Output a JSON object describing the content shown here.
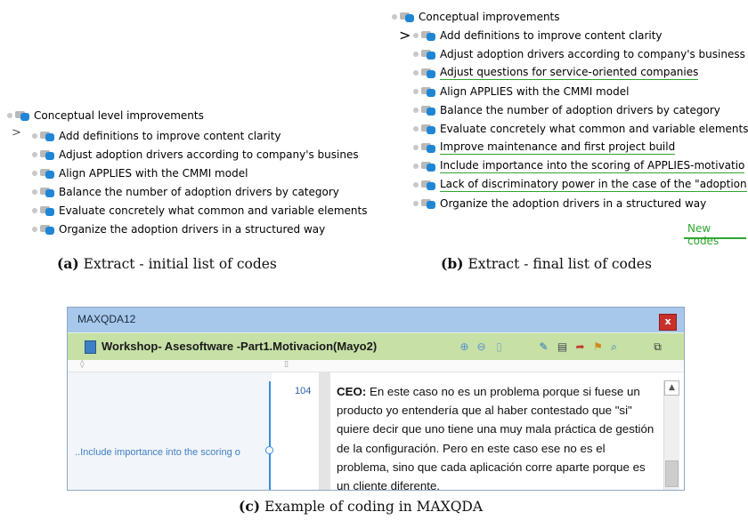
{
  "panel_a": {
    "root": "Conceptual level improvements",
    "items": [
      "Add definitions to improve content clarity",
      "Adjust adoption drivers according to company's busines",
      "Align APPLIES with the CMMI model",
      "Balance the number of adoption drivers by category",
      "Evaluate concretely what common and variable elements",
      "Organize the adoption drivers in a structured way"
    ],
    "caption_label": "(a)",
    "caption_text": "Extract - initial list of codes"
  },
  "panel_b": {
    "root": "Conceptual improvements",
    "items": [
      "Add definitions to improve content clarity",
      "Adjust adoption drivers according to company's business",
      "Adjust questions for service-oriented companies",
      "Align APPLIES with the CMMI model",
      "Balance the number of adoption drivers by category",
      "Evaluate concretely what common and variable elements t",
      "Improve maintenance and first project build",
      "Include importance into the scoring of APPLIES-motivatio",
      "Lack of discriminatory power in the case of the \"adoption",
      "Organize the adoption drivers in a structured way"
    ],
    "new_codes_label": "New codes",
    "caption_label": "(b)",
    "caption_text": "Extract - final list of codes"
  },
  "panel_c": {
    "app_title": "MAXQDA12",
    "close_symbol": "x",
    "document_title": "Workshop- Asesoftware -Part1.Motivacion(Mayo2)",
    "paragraph_number": "104",
    "code_label": "..Include importance into the scoring o",
    "speaker": "CEO:",
    "text": " En este caso no es un problema porque si fuese un producto yo entendería que al haber contestado que \"si\" quiere decir que uno tiene una muy mala práctica de gestión de la configuración. Pero en este caso ese no es el problema, sino que cada aplicación corre aparte porque es un cliente diferente.",
    "caption_label": "(c)",
    "caption_text": "Example of coding in MAXQDA",
    "colors": {
      "titlebar": "#a7c8ea",
      "docbar": "#c6e0a6",
      "code_link": "#3a8ee0",
      "new_codes": "#2fa62f"
    }
  }
}
